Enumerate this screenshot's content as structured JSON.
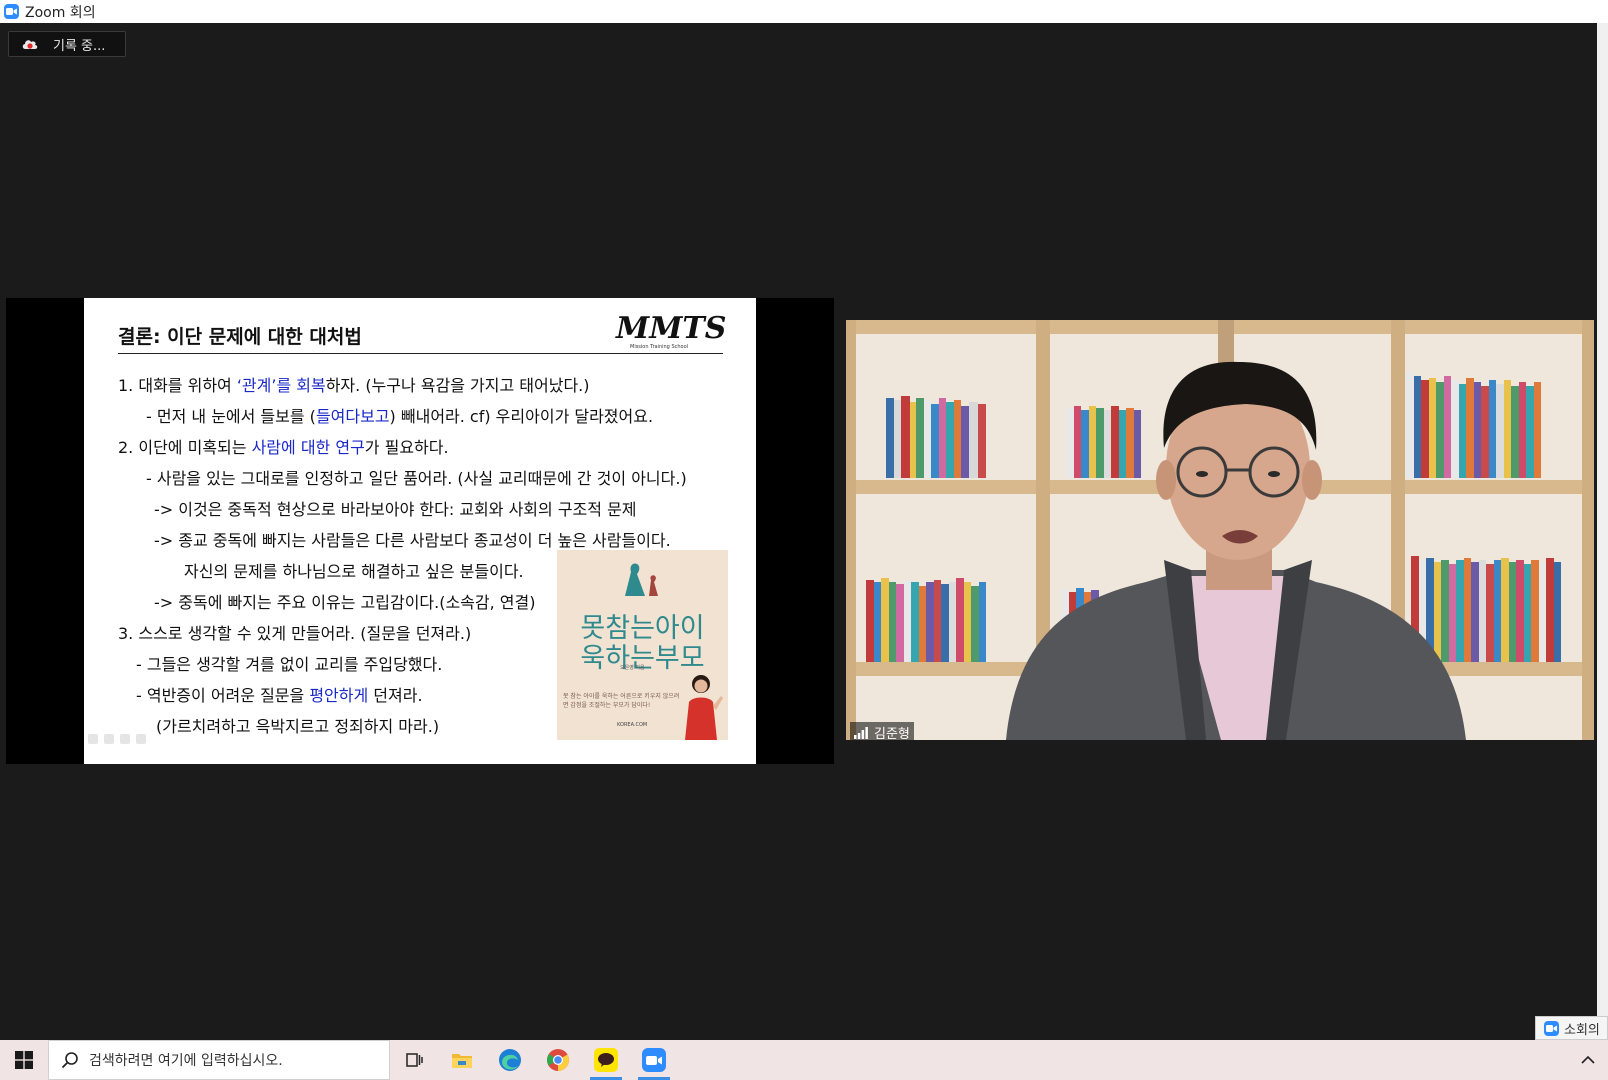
{
  "window": {
    "title": "Zoom 회의"
  },
  "recording": {
    "label": "기록 중..."
  },
  "slide": {
    "heading": "결론: 이단 문제에 대한 대처법",
    "logo": "MMTS",
    "logo_subtitle": "Mission Training School",
    "lines": [
      {
        "pre": "1.   대화를 위하여  ",
        "hl": "‘관계’를 회복",
        "post": "하자. (누구나 욕감을 가지고 태어났다.)"
      },
      {
        "pre": "- 먼저 내 눈에서 들보를 (",
        "hl": "들여다보고",
        "post": ") 빼내어라.   cf) 우리아이가 달라졌어요."
      },
      {
        "pre": "2. 이단에 미혹되는 ",
        "hl": "사람에 대한 연구",
        "post": "가 필요하다."
      },
      {
        "pre": "- 사람을 있는 그대로를 인정하고 일단 품어라. (사실 교리때문에 간 것이 아니다.)",
        "hl": "",
        "post": ""
      },
      {
        "pre": "-> 이것은 중독적 현상으로 바라보아야 한다: 교회와 사회의 구조적 문제",
        "hl": "",
        "post": ""
      },
      {
        "pre": "-> 종교 중독에 빠지는 사람들은 다른 사람보다 종교성이 더 높은 사람들이다.",
        "hl": "",
        "post": ""
      },
      {
        "pre": "자신의 문제를 하나님으로 해결하고 싶은 분들이다.",
        "hl": "",
        "post": ""
      },
      {
        "pre": "-> 중독에 빠지는 주요 이유는 고립감이다.(소속감, 연결)",
        "hl": "",
        "post": ""
      },
      {
        "pre": "3. 스스로 생각할 수 있게 만들어라. (질문을 던져라.)",
        "hl": "",
        "post": ""
      },
      {
        "pre": "- 그들은 생각할 겨를 없이 교리를 주입당했다.",
        "hl": "",
        "post": ""
      },
      {
        "pre": "- 역반증이 어려운 질문을 ",
        "hl": "평안하게",
        "post": " 던져라."
      },
      {
        "pre": "(가르치려하고 윽박지르고 정죄하지 마라.)",
        "hl": "",
        "post": ""
      }
    ],
    "book": {
      "title_line1": "못참는아이",
      "title_line2": "욱하는부모",
      "author": "오은영 지음",
      "blurb": "못 참는 아이를 욱하는 어른으로 키우지 않으려면 감정을 조절하는 부모가 답이다!",
      "publisher": "KOREA.COM"
    }
  },
  "video": {
    "participant_name": "김준형"
  },
  "breakout": {
    "label": "소회의"
  },
  "taskbar": {
    "search_placeholder": "검색하려면 여기에 입력하십시오."
  },
  "colors": {
    "zoom_blue": "#2d8cff",
    "highlight_blue": "#1a28c8",
    "background": "#1b1b1b"
  }
}
